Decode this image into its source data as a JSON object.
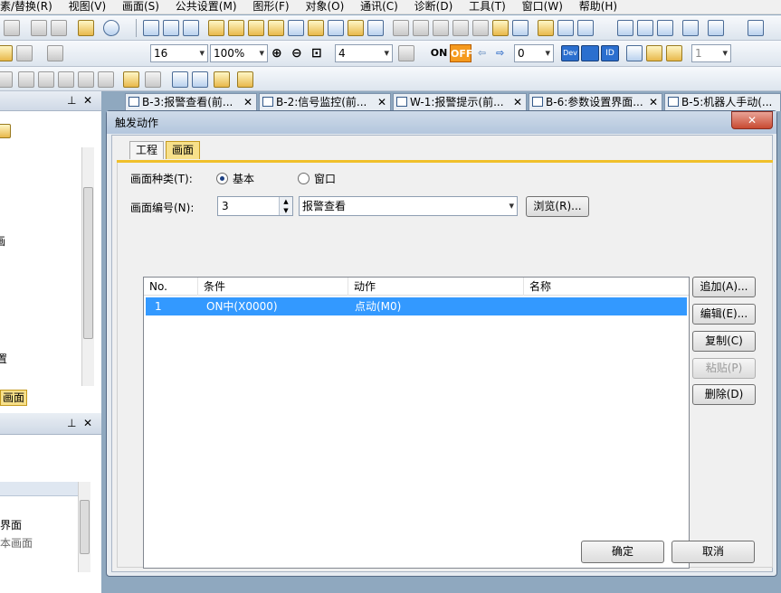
{
  "menubar": {
    "items": [
      "素/替换(R)",
      "视图(V)",
      "画面(S)",
      "公共设置(M)",
      "图形(F)",
      "对象(O)",
      "通讯(C)",
      "诊断(D)",
      "工具(T)",
      "窗口(W)",
      "帮助(H)"
    ]
  },
  "toolbar": {
    "font_size": "16",
    "zoom": "100%",
    "grid_size": "4",
    "on_label": "ON",
    "off_label": "OFF",
    "device_value": "0",
    "dev_label": "Dev",
    "id_label": "ID",
    "layer_value": "1"
  },
  "left_panel": {
    "label_screen": "画面",
    "label_screen_item": "界面",
    "label_base_screen": "本画面"
  },
  "doc_tabs": [
    {
      "label": "B-3:报警查看(前..."
    },
    {
      "label": "B-2:信号监控(前..."
    },
    {
      "label": "W-1:报警提示(前..."
    },
    {
      "label": "B-6:参数设置界面..."
    },
    {
      "label": "B-5:机器人手动(..."
    }
  ],
  "dialog": {
    "title": "触发动作",
    "close": "✕",
    "tabs": {
      "project": "工程",
      "screen": "画面"
    },
    "screen_type_label": "画面种类(T):",
    "radio_basic": "基本",
    "radio_window": "窗口",
    "screen_number_label": "画面编号(N):",
    "screen_number": "3",
    "screen_name": "报警查看",
    "browse_button": "浏览(R)...",
    "columns": {
      "no": "No.",
      "condition": "条件",
      "action": "动作",
      "name": "名称"
    },
    "rows": [
      {
        "no": "1",
        "condition": "ON中(X0000)",
        "action": "点动(M0)",
        "name": ""
      }
    ],
    "buttons": {
      "add": "追加(A)...",
      "edit": "编辑(E)...",
      "copy": "复制(C)",
      "paste": "粘贴(P)",
      "delete": "删除(D)",
      "ok": "确定",
      "cancel": "取消"
    }
  }
}
